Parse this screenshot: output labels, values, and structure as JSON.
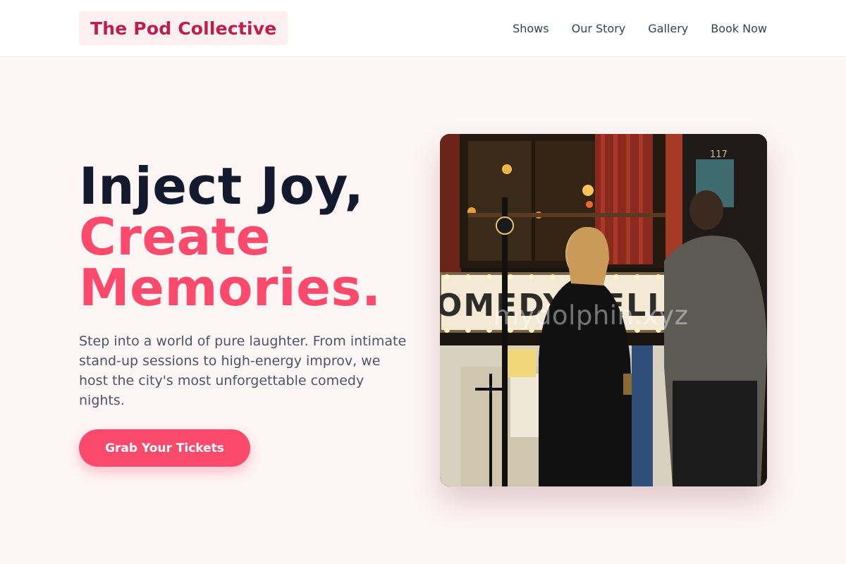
{
  "header": {
    "logo": "The Pod Collective",
    "nav": [
      "Shows",
      "Our Story",
      "Gallery",
      "Book Now"
    ]
  },
  "hero": {
    "headline_line1": "Inject Joy,",
    "headline_line2": "Create",
    "headline_line3": "Memories.",
    "description": "Step into a world of pure laughter. From intimate stand-up sessions to high-energy improv, we host the city's most unforgettable comedy nights.",
    "cta_label": "Grab Your Tickets",
    "image": {
      "sign_text": "OMEDY CELLAR",
      "door_number": "117",
      "watermark": "mydolphin.xyz"
    }
  },
  "colors": {
    "accent": "#fc4a6d",
    "logo_text": "#be1e4e",
    "heading_dark": "#141a2e",
    "page_bg": "#fef5f5"
  }
}
